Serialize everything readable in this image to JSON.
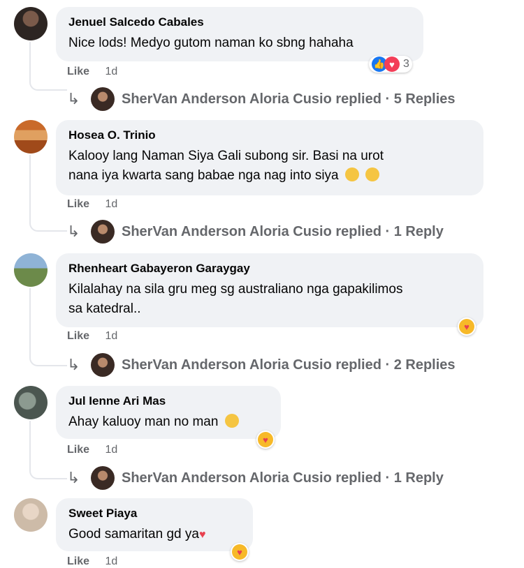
{
  "comments": [
    {
      "name": "Jenuel Salcedo Cabales",
      "text": "Nice lods! Medyo gutom naman ko sbng hahaha",
      "like": "Like",
      "time": "1d",
      "reaction_count": "3",
      "reply_link": "SherVan Anderson Aloria Cusio replied · 5 Replies"
    },
    {
      "name": "Hosea O. Trinio",
      "text_line1": "Kalooy lang Naman Siya Gali subong sir. Basi na urot",
      "text_line2": "nana iya kwarta sang babae nga nag into siya",
      "like": "Like",
      "time": "1d",
      "reply_link": "SherVan Anderson Aloria Cusio replied · 1 Reply"
    },
    {
      "name": "Rhenheart Gabayeron Garaygay",
      "text_line1": "Kilalahay na sila gru meg sg australiano nga gapakilimos",
      "text_line2": "sa katedral..",
      "like": "Like",
      "time": "1d",
      "reply_link": "SherVan Anderson Aloria Cusio replied · 2 Replies"
    },
    {
      "name": "Jul Ienne Ari Mas",
      "text": "Ahay kaluoy man no man",
      "like": "Like",
      "time": "1d",
      "reply_link": "SherVan Anderson Aloria Cusio replied · 1 Reply"
    },
    {
      "name": "Sweet Piaya",
      "text": "Good samaritan gd ya",
      "like": "Like",
      "time": "1d"
    }
  ]
}
